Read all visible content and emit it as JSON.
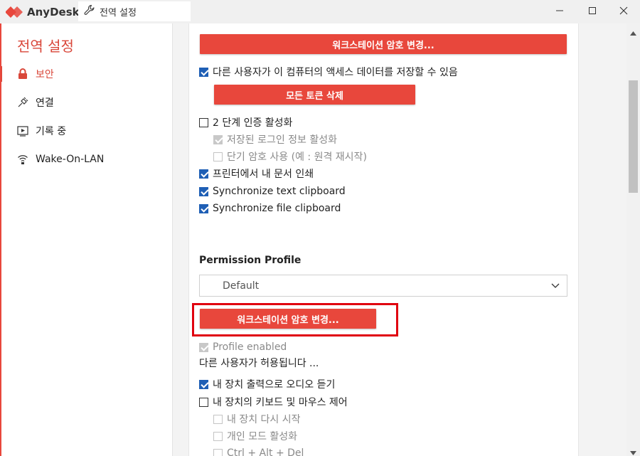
{
  "app": {
    "name": "AnyDesk",
    "tab_title": "전역 설정",
    "brand_color": "#e8473c"
  },
  "sidebar": {
    "title": "전역 설정",
    "items": [
      {
        "label": "보안",
        "icon": "lock-icon",
        "active": true
      },
      {
        "label": "연결",
        "icon": "plug-icon",
        "active": false
      },
      {
        "label": "기록 중",
        "icon": "record-icon",
        "active": false
      },
      {
        "label": "Wake-On-LAN",
        "icon": "wifi-icon",
        "active": false
      }
    ]
  },
  "main": {
    "change_password_button_top": "워크스테이션 암호 변경...",
    "allow_access_data": {
      "label": "다른 사용자가 이 컴퓨터의 액세스 데이터를 저장할 수 있음",
      "checked": true
    },
    "delete_tokens_button": "모든 토큰 삭제",
    "two_factor": {
      "label": "2 단계 인증 활성화",
      "checked": false
    },
    "saved_login": {
      "label": "저장된 로그인 정보 활성화",
      "checked": true,
      "disabled": true
    },
    "short_password": {
      "label": "단기 암호 사용 (예 : 원격 재시작)",
      "checked": false,
      "disabled": true
    },
    "print_docs": {
      "label": "프린터에서 내 문서 인쇄",
      "checked": true
    },
    "sync_text": {
      "label": "Synchronize text clipboard",
      "checked": true
    },
    "sync_file": {
      "label": "Synchronize file clipboard",
      "checked": true
    },
    "permission_profile_title": "Permission Profile",
    "permission_profile_value": "Default",
    "change_password_button_profile": "워크스테이션 암호 변경...",
    "profile_enabled": {
      "label": "Profile enabled",
      "checked": true,
      "disabled": true
    },
    "others_allowed_text": "다른 사용자가 허용됩니다 ...",
    "hear_audio": {
      "label": "내 장치 출력으로 오디오 듣기",
      "checked": true
    },
    "control_input": {
      "label": "내 장치의 키보드 및 마우스 제어",
      "checked": false
    },
    "restart_device": {
      "label": "내 장치 다시 시작",
      "checked": false,
      "disabled": true
    },
    "privacy_mode": {
      "label": "개인 모드 활성화",
      "checked": false,
      "disabled": true
    },
    "ctrl_alt_del": {
      "label": "Ctrl + Alt + Del",
      "checked": false,
      "disabled": true
    }
  }
}
